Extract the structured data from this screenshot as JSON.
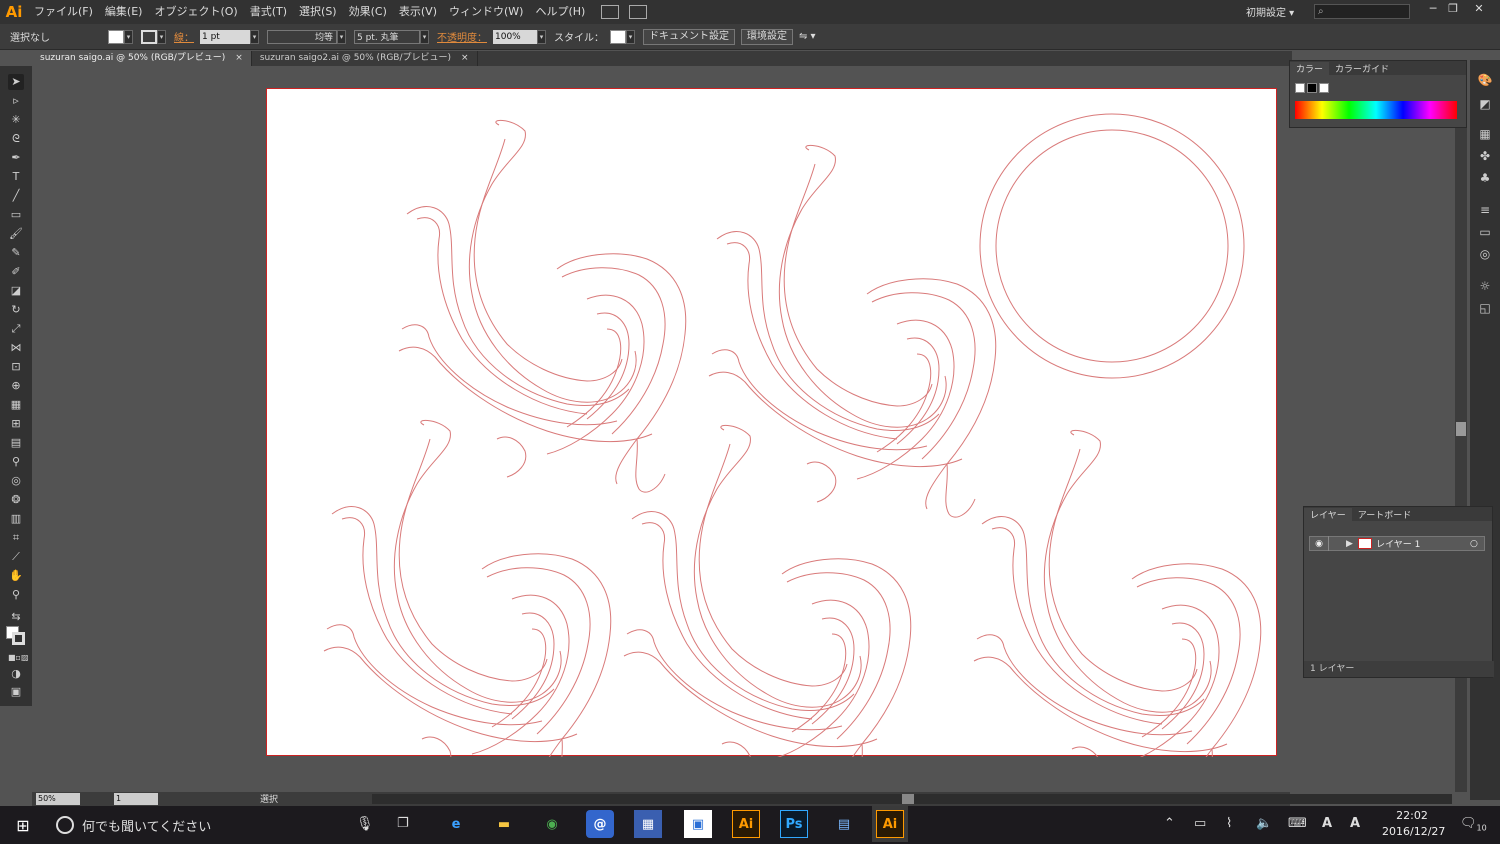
{
  "menubar": {
    "logo": "Ai",
    "items": [
      "ファイル(F)",
      "編集(E)",
      "オブジェクト(O)",
      "書式(T)",
      "選択(S)",
      "効果(C)",
      "表示(V)",
      "ウィンドウ(W)",
      "ヘルプ(H)"
    ],
    "workspace": "初期設定",
    "search_placeholder": ""
  },
  "controlbar": {
    "selection": "選択なし",
    "stroke_label": "線：",
    "stroke_weight": "1 pt",
    "stroke_profile": "均等",
    "brush": "5 pt. 丸筆",
    "opacity_label": "不透明度：",
    "opacity_value": "100%",
    "style_label": "スタイル：",
    "doc_settings": "ドキュメント設定",
    "preferences": "環境設定"
  },
  "tabs": [
    {
      "label": "suzuran saigo.ai @ 50% (RGB/プレビュー)",
      "close": "×"
    },
    {
      "label": "suzuran saigo2.ai @ 50% (RGB/プレビュー)",
      "close": "×"
    }
  ],
  "statusbar": {
    "zoom": "50%",
    "page": "1",
    "tool_label": "選択"
  },
  "color_panel": {
    "tabs": [
      "カラー",
      "カラーガイド"
    ]
  },
  "layer_panel": {
    "tabs": [
      "レイヤー",
      "アートボード"
    ],
    "layer_name": "レイヤー 1",
    "footer": "1 レイヤー"
  },
  "taskbar": {
    "search_text": "何でも聞いてください",
    "time": "22:02",
    "date": "2016/12/27",
    "notification_count": "10",
    "apps": [
      "edge",
      "explorer",
      "chrome",
      "mail",
      "calc",
      "store",
      "Ai",
      "Ps",
      "outlook",
      "Ai"
    ]
  },
  "colors": {
    "accent": "#ff9a00",
    "path_stroke": "#d97a7a",
    "artboard_border": "#cc2222"
  }
}
